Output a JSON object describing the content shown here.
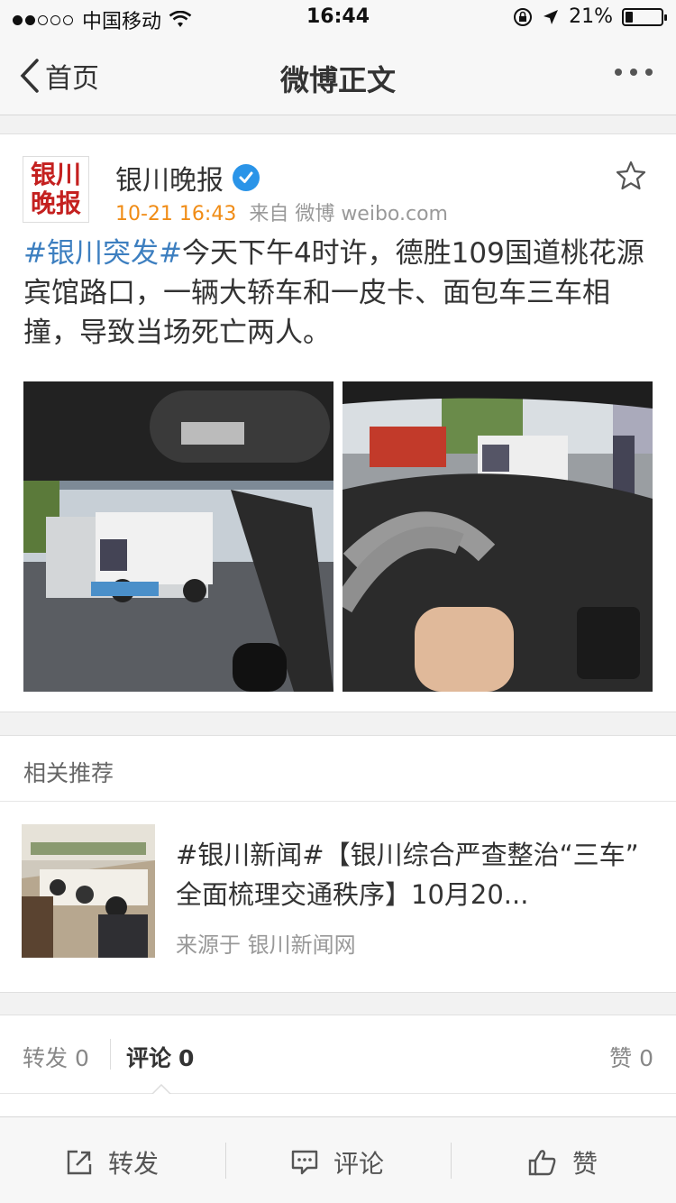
{
  "status_bar": {
    "carrier": "中国移动",
    "time": "16:44",
    "battery": "21%",
    "battery_level": 0.21
  },
  "nav": {
    "back_label": "首页",
    "title": "微博正文"
  },
  "post": {
    "author": "银川晚报",
    "avatar_text_line1": "银川",
    "avatar_text_line2": "晚报",
    "time": "10-21 16:43",
    "source": "来自 微博 weibo.com",
    "hashtag": "#银川突发#",
    "text": "今天下午4时许，德胜109国道桃花源宾馆路口，一辆大轿车和一皮卡、面包车三车相撞，导致当场死亡两人。"
  },
  "related": {
    "section_title": "相关推荐",
    "item": {
      "title": "#银川新闻#【银川综合严查整治“三车” 全面梳理交通秩序】10月20...",
      "source": "来源于 银川新闻网"
    }
  },
  "tabs": {
    "repost_label": "转发",
    "repost_count": "0",
    "comment_label": "评论",
    "comment_count": "0",
    "like_label": "赞",
    "like_count": "0"
  },
  "toolbar": {
    "repost": "转发",
    "comment": "评论",
    "like": "赞"
  },
  "colors": {
    "link_blue": "#3d7fc0",
    "time_orange": "#f08c16",
    "verified_blue": "#2a94e8",
    "avatar_red": "#c4201f"
  }
}
